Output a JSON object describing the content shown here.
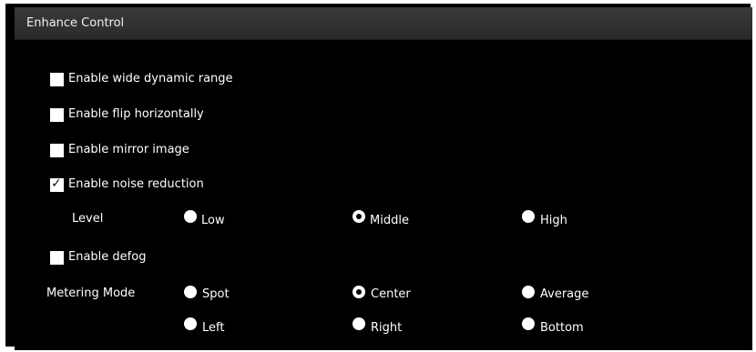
{
  "panel": {
    "title": "Enhance Control"
  },
  "options": {
    "wdr": {
      "label": "Enable wide dynamic range",
      "checked": false
    },
    "flip": {
      "label": "Enable flip horizontally",
      "checked": false
    },
    "mirror": {
      "label": "Enable mirror image",
      "checked": false
    },
    "noise": {
      "label": "Enable noise reduction",
      "checked": true
    },
    "defog": {
      "label": "Enable defog",
      "checked": false
    }
  },
  "noise_level": {
    "label": "Level",
    "options": [
      "Low",
      "Middle",
      "High"
    ],
    "selected": "Middle"
  },
  "metering": {
    "label": "Metering Mode",
    "options": [
      "Spot",
      "Center",
      "Average",
      "Left",
      "Right",
      "Bottom"
    ],
    "selected": "Center"
  },
  "colors": {
    "background": "#000000",
    "header": "#2f2f2f",
    "text": "#ffffff"
  }
}
